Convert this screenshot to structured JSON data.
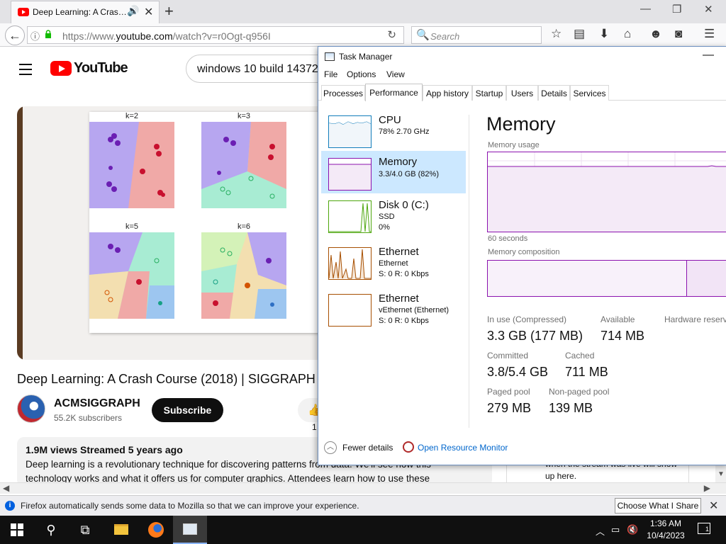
{
  "browser": {
    "tab_title": "Deep Learning: A Cras…",
    "url_prefix": "https://www.",
    "url_domain": "youtube.com",
    "url_path": "/watch?v=r0Ogt-q956I",
    "search_placeholder": "Search",
    "notification": "Firefox automatically sends some data to Mozilla so that we can improve your experience.",
    "notification_button": "Choose What I Share"
  },
  "youtube": {
    "wordmark": "YouTube",
    "search_query": "windows 10 build 14372",
    "video_title": "Deep Learning: A Crash Course (2018) | SIGGRAPH",
    "channel_name": "ACMSIGGRAPH",
    "subscribers": "55.2K subscribers",
    "subscribe_label": "Subscribe",
    "like_count": "1",
    "views_meta": "1.9M views  Streamed 5 years ago",
    "description": "Deep learning is a revolutionary technique for discovering patterns from data. We'll see how this technology works and what it offers us for computer graphics. Attendees learn how to use these",
    "chat_text": "when the stream was live will show up here.",
    "slide_panels": [
      "k=2",
      "k=3",
      "k=5",
      "k=6"
    ]
  },
  "task_manager": {
    "title": "Task Manager",
    "menu": [
      "File",
      "Options",
      "View"
    ],
    "tabs": [
      "Processes",
      "Performance",
      "App history",
      "Startup",
      "Users",
      "Details",
      "Services"
    ],
    "active_tab": "Performance",
    "resources": [
      {
        "name": "CPU",
        "line1": "78%  2.70 GHz",
        "line2": ""
      },
      {
        "name": "Memory",
        "line1": "3.3/4.0 GB (82%)",
        "line2": ""
      },
      {
        "name": "Disk 0 (C:)",
        "line1": "SSD",
        "line2": "0%"
      },
      {
        "name": "Ethernet",
        "line1": "Ethernet",
        "line2": "S: 0  R: 0 Kbps"
      },
      {
        "name": "Ethernet",
        "line1": "vEthernet (Ethernet)",
        "line2": "S: 0  R: 0 Kbps"
      }
    ],
    "detail_title": "Memory",
    "usage_label": "Memory usage",
    "seconds_label": "60 seconds",
    "composition_label": "Memory composition",
    "memory_in_use_fraction": 0.82,
    "stats": {
      "in_use_label": "In use (Compressed)",
      "in_use": "3.3 GB (177 MB)",
      "available_label": "Available",
      "available": "714 MB",
      "hw_reserved_label": "Hardware reserved",
      "committed_label": "Committed",
      "committed": "3.8/5.4 GB",
      "cached_label": "Cached",
      "cached": "711 MB",
      "paged_label": "Paged pool",
      "paged": "279 MB",
      "nonpaged_label": "Non-paged pool",
      "nonpaged": "139 MB"
    },
    "fewer_details": "Fewer details",
    "resource_monitor": "Open Resource Monitor"
  },
  "taskbar": {
    "time": "1:36 AM",
    "date": "10/4/2023",
    "notification_count": "1"
  },
  "colors": {
    "youtube_red": "#ff0000",
    "memory_purple": "#8b12ae",
    "cpu_blue": "#117dbb",
    "disk_green": "#4da60c",
    "ethernet_brown": "#a74f01",
    "selected_bg": "#cce8ff"
  }
}
